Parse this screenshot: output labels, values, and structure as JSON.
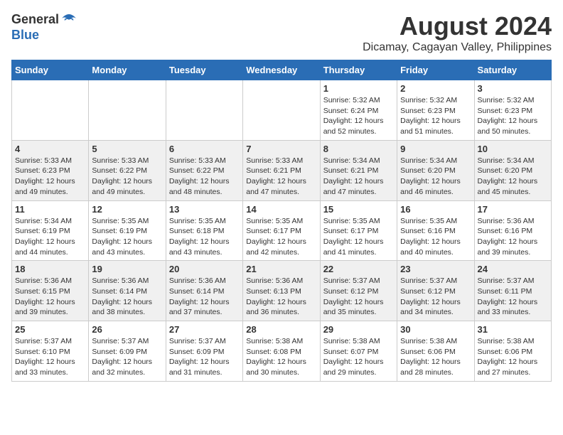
{
  "logo": {
    "line1": "General",
    "line2": "Blue"
  },
  "title": "August 2024",
  "subtitle": "Dicamay, Cagayan Valley, Philippines",
  "days_of_week": [
    "Sunday",
    "Monday",
    "Tuesday",
    "Wednesday",
    "Thursday",
    "Friday",
    "Saturday"
  ],
  "weeks": [
    [
      {
        "day": "",
        "info": ""
      },
      {
        "day": "",
        "info": ""
      },
      {
        "day": "",
        "info": ""
      },
      {
        "day": "",
        "info": ""
      },
      {
        "day": "1",
        "info": "Sunrise: 5:32 AM\nSunset: 6:24 PM\nDaylight: 12 hours\nand 52 minutes."
      },
      {
        "day": "2",
        "info": "Sunrise: 5:32 AM\nSunset: 6:23 PM\nDaylight: 12 hours\nand 51 minutes."
      },
      {
        "day": "3",
        "info": "Sunrise: 5:32 AM\nSunset: 6:23 PM\nDaylight: 12 hours\nand 50 minutes."
      }
    ],
    [
      {
        "day": "4",
        "info": "Sunrise: 5:33 AM\nSunset: 6:23 PM\nDaylight: 12 hours\nand 49 minutes."
      },
      {
        "day": "5",
        "info": "Sunrise: 5:33 AM\nSunset: 6:22 PM\nDaylight: 12 hours\nand 49 minutes."
      },
      {
        "day": "6",
        "info": "Sunrise: 5:33 AM\nSunset: 6:22 PM\nDaylight: 12 hours\nand 48 minutes."
      },
      {
        "day": "7",
        "info": "Sunrise: 5:33 AM\nSunset: 6:21 PM\nDaylight: 12 hours\nand 47 minutes."
      },
      {
        "day": "8",
        "info": "Sunrise: 5:34 AM\nSunset: 6:21 PM\nDaylight: 12 hours\nand 47 minutes."
      },
      {
        "day": "9",
        "info": "Sunrise: 5:34 AM\nSunset: 6:20 PM\nDaylight: 12 hours\nand 46 minutes."
      },
      {
        "day": "10",
        "info": "Sunrise: 5:34 AM\nSunset: 6:20 PM\nDaylight: 12 hours\nand 45 minutes."
      }
    ],
    [
      {
        "day": "11",
        "info": "Sunrise: 5:34 AM\nSunset: 6:19 PM\nDaylight: 12 hours\nand 44 minutes."
      },
      {
        "day": "12",
        "info": "Sunrise: 5:35 AM\nSunset: 6:19 PM\nDaylight: 12 hours\nand 43 minutes."
      },
      {
        "day": "13",
        "info": "Sunrise: 5:35 AM\nSunset: 6:18 PM\nDaylight: 12 hours\nand 43 minutes."
      },
      {
        "day": "14",
        "info": "Sunrise: 5:35 AM\nSunset: 6:17 PM\nDaylight: 12 hours\nand 42 minutes."
      },
      {
        "day": "15",
        "info": "Sunrise: 5:35 AM\nSunset: 6:17 PM\nDaylight: 12 hours\nand 41 minutes."
      },
      {
        "day": "16",
        "info": "Sunrise: 5:35 AM\nSunset: 6:16 PM\nDaylight: 12 hours\nand 40 minutes."
      },
      {
        "day": "17",
        "info": "Sunrise: 5:36 AM\nSunset: 6:16 PM\nDaylight: 12 hours\nand 39 minutes."
      }
    ],
    [
      {
        "day": "18",
        "info": "Sunrise: 5:36 AM\nSunset: 6:15 PM\nDaylight: 12 hours\nand 39 minutes."
      },
      {
        "day": "19",
        "info": "Sunrise: 5:36 AM\nSunset: 6:14 PM\nDaylight: 12 hours\nand 38 minutes."
      },
      {
        "day": "20",
        "info": "Sunrise: 5:36 AM\nSunset: 6:14 PM\nDaylight: 12 hours\nand 37 minutes."
      },
      {
        "day": "21",
        "info": "Sunrise: 5:36 AM\nSunset: 6:13 PM\nDaylight: 12 hours\nand 36 minutes."
      },
      {
        "day": "22",
        "info": "Sunrise: 5:37 AM\nSunset: 6:12 PM\nDaylight: 12 hours\nand 35 minutes."
      },
      {
        "day": "23",
        "info": "Sunrise: 5:37 AM\nSunset: 6:12 PM\nDaylight: 12 hours\nand 34 minutes."
      },
      {
        "day": "24",
        "info": "Sunrise: 5:37 AM\nSunset: 6:11 PM\nDaylight: 12 hours\nand 33 minutes."
      }
    ],
    [
      {
        "day": "25",
        "info": "Sunrise: 5:37 AM\nSunset: 6:10 PM\nDaylight: 12 hours\nand 33 minutes."
      },
      {
        "day": "26",
        "info": "Sunrise: 5:37 AM\nSunset: 6:09 PM\nDaylight: 12 hours\nand 32 minutes."
      },
      {
        "day": "27",
        "info": "Sunrise: 5:37 AM\nSunset: 6:09 PM\nDaylight: 12 hours\nand 31 minutes."
      },
      {
        "day": "28",
        "info": "Sunrise: 5:38 AM\nSunset: 6:08 PM\nDaylight: 12 hours\nand 30 minutes."
      },
      {
        "day": "29",
        "info": "Sunrise: 5:38 AM\nSunset: 6:07 PM\nDaylight: 12 hours\nand 29 minutes."
      },
      {
        "day": "30",
        "info": "Sunrise: 5:38 AM\nSunset: 6:06 PM\nDaylight: 12 hours\nand 28 minutes."
      },
      {
        "day": "31",
        "info": "Sunrise: 5:38 AM\nSunset: 6:06 PM\nDaylight: 12 hours\nand 27 minutes."
      }
    ]
  ]
}
